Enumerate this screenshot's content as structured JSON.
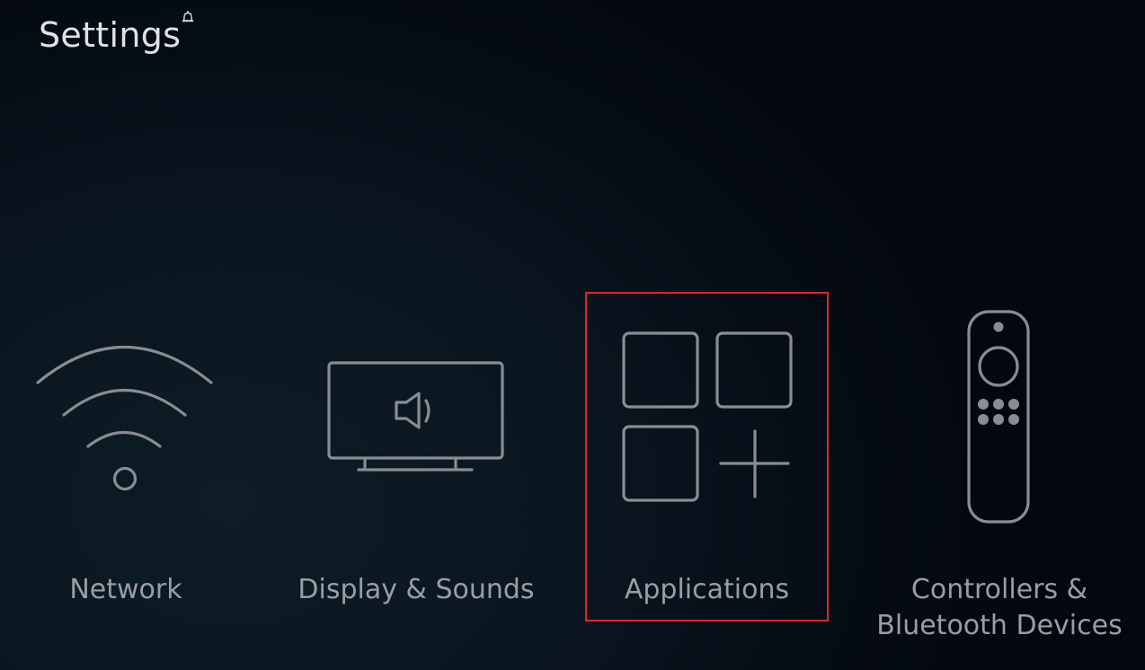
{
  "header": {
    "title": "Settings",
    "notification_icon": "bell-icon"
  },
  "menu": {
    "items": [
      {
        "id": "network",
        "label": "Network",
        "icon": "wifi-icon",
        "selected": false
      },
      {
        "id": "display-sounds",
        "label": "Display & Sounds",
        "icon": "tv-speaker-icon",
        "selected": false
      },
      {
        "id": "applications",
        "label": "Applications",
        "icon": "apps-grid-plus-icon",
        "selected": true
      },
      {
        "id": "controllers-bluetooth",
        "label_line1": "Controllers &",
        "label_line2": "Bluetooth Devices",
        "icon": "remote-control-icon",
        "selected": false
      }
    ]
  },
  "colors": {
    "focus_border": "#e3232c",
    "icon_stroke": "#8a8d90",
    "label_text": "#9a9ea2",
    "title_text": "#dfe1e3"
  }
}
